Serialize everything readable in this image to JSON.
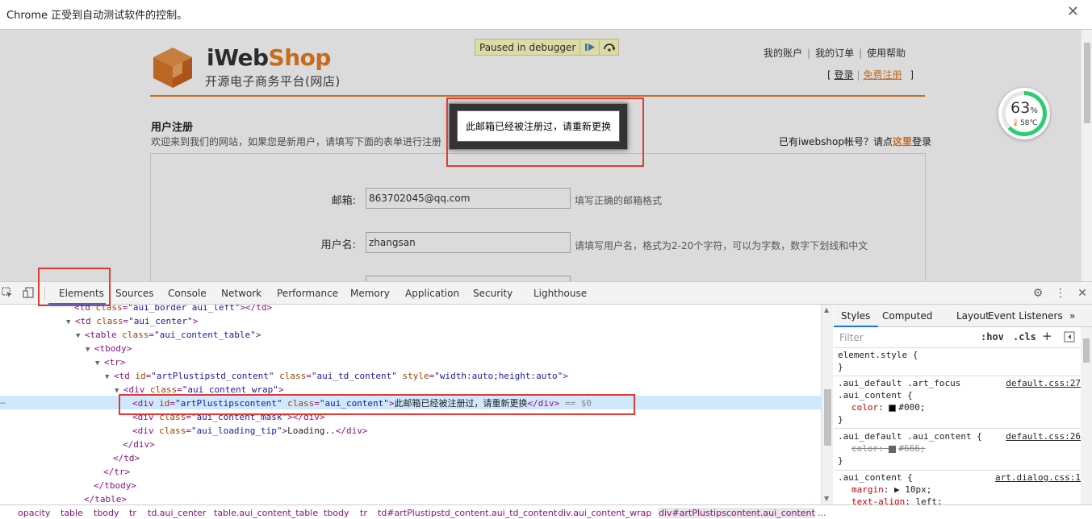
{
  "infobar": {
    "message": "Chrome 正受到自动测试软件的控制。",
    "close_glyph": "✕"
  },
  "page": {
    "logo_word_1": "iWeb",
    "logo_word_2": "Shop",
    "logo_sub": "开源电子商务平台(网店)",
    "debugger": {
      "label": "Paused in debugger"
    },
    "top_links": [
      "我的账户",
      "我的订单",
      "使用帮助"
    ],
    "login": {
      "open": "[",
      "login": "登录",
      "sep": "|",
      "register": "免费注册",
      "close": "]"
    },
    "reg_title": "用户注册",
    "reg_desc": "欢迎来到我们的网站，如果您是新用户，请填写下面的表单进行注册",
    "have_account": {
      "prefix": "已有iwebshop帐号？请点",
      "here": "这里",
      "suffix": "登录"
    },
    "form": {
      "email": {
        "label": "邮箱:",
        "value": "863702045@qq.com",
        "hint": "填写正确的邮箱格式"
      },
      "username": {
        "label": "用户名:",
        "value": "zhangsan",
        "hint": "请填写用户名，格式为2-20个字符，可以为字数，数字下划线和中文"
      }
    },
    "alert": {
      "message": "此邮箱已经被注册过，请重新更换"
    },
    "gauge": {
      "percent": "63",
      "percent_unit": "%",
      "temp": "58℃",
      "level": 0.63,
      "color": "#2ecc71"
    }
  },
  "devtools": {
    "tabs": [
      "Elements",
      "Sources",
      "Console",
      "Network",
      "Performance",
      "Memory",
      "Application",
      "Security",
      "Lighthouse"
    ],
    "active_tab": "Elements",
    "dom_lines": [
      {
        "indent": 0,
        "html": "<td class=\"aui_border aui_left\"></td>"
      },
      {
        "indent": 0,
        "html": "<td class=\"aui_center\">"
      },
      {
        "indent": 1,
        "html": "<table class=\"aui_content_table\">"
      },
      {
        "indent": 2,
        "html": "<tbody>"
      },
      {
        "indent": 3,
        "html": "<tr>"
      },
      {
        "indent": 4,
        "html": "<td id=\"artPlustipstd_content\" class=\"aui_td_content\" style=\"width:auto;height:auto\">"
      },
      {
        "indent": 5,
        "html": "<div class=\"aui_content_wrap\">"
      },
      {
        "indent": 6,
        "html": "<div id=\"artPlustipscontent\" class=\"aui_content\">此邮箱已经被注册过，请重新更换</div> == $0"
      },
      {
        "indent": 6,
        "html": "<div class=\"aui_content_mask\"></div>"
      },
      {
        "indent": 6,
        "html": "<div class=\"aui_loading_tip\">Loading..</div>"
      },
      {
        "indent": 5,
        "html": "</div>"
      },
      {
        "indent": 4,
        "html": "</td>"
      },
      {
        "indent": 3,
        "html": "</tr>"
      },
      {
        "indent": 2,
        "html": "</tbody>"
      },
      {
        "indent": 1,
        "html": "</table>"
      }
    ],
    "styles_tabs": [
      "Styles",
      "Computed",
      "Layout",
      "Event Listeners",
      "»"
    ],
    "filter_placeholder": "Filter",
    "filter_hov": ":hov",
    "filter_cls": ".cls",
    "filter_plus": "+",
    "rules": [
      {
        "selector": "element.style {",
        "source": "",
        "props": [],
        "close": "}"
      },
      {
        "selector": ".aui_default .art_focus",
        "selector2": ".aui_content {",
        "source": "default.css:27",
        "props": [
          {
            "name": "color",
            "value": "#000",
            "swatch": "#000000",
            "strike": false
          }
        ],
        "close": "}"
      },
      {
        "selector": ".aui_default .aui_content {",
        "source": "default.css:26",
        "props": [
          {
            "name": "color",
            "value": "#666",
            "swatch": "#666666",
            "strike": true
          }
        ],
        "close": "}"
      },
      {
        "selector": ".aui_content {",
        "source": "art.dialog.css:1",
        "props": [
          {
            "name": "margin",
            "value": "▶ 10px",
            "swatch": "",
            "strike": false
          },
          {
            "name": "text-align",
            "value": "left",
            "swatch": "",
            "strike": false
          }
        ],
        "close": ""
      }
    ],
    "breadcrumbs": [
      "opacity",
      "table",
      "tbody",
      "tr",
      "td.aui_center",
      "table.aui_content_table",
      "tbody",
      "tr",
      "td#artPlustipstd_content.aui_td_content",
      "div.aui_content_wrap",
      "div#artPlustipscontent.aui_content",
      "..."
    ]
  }
}
